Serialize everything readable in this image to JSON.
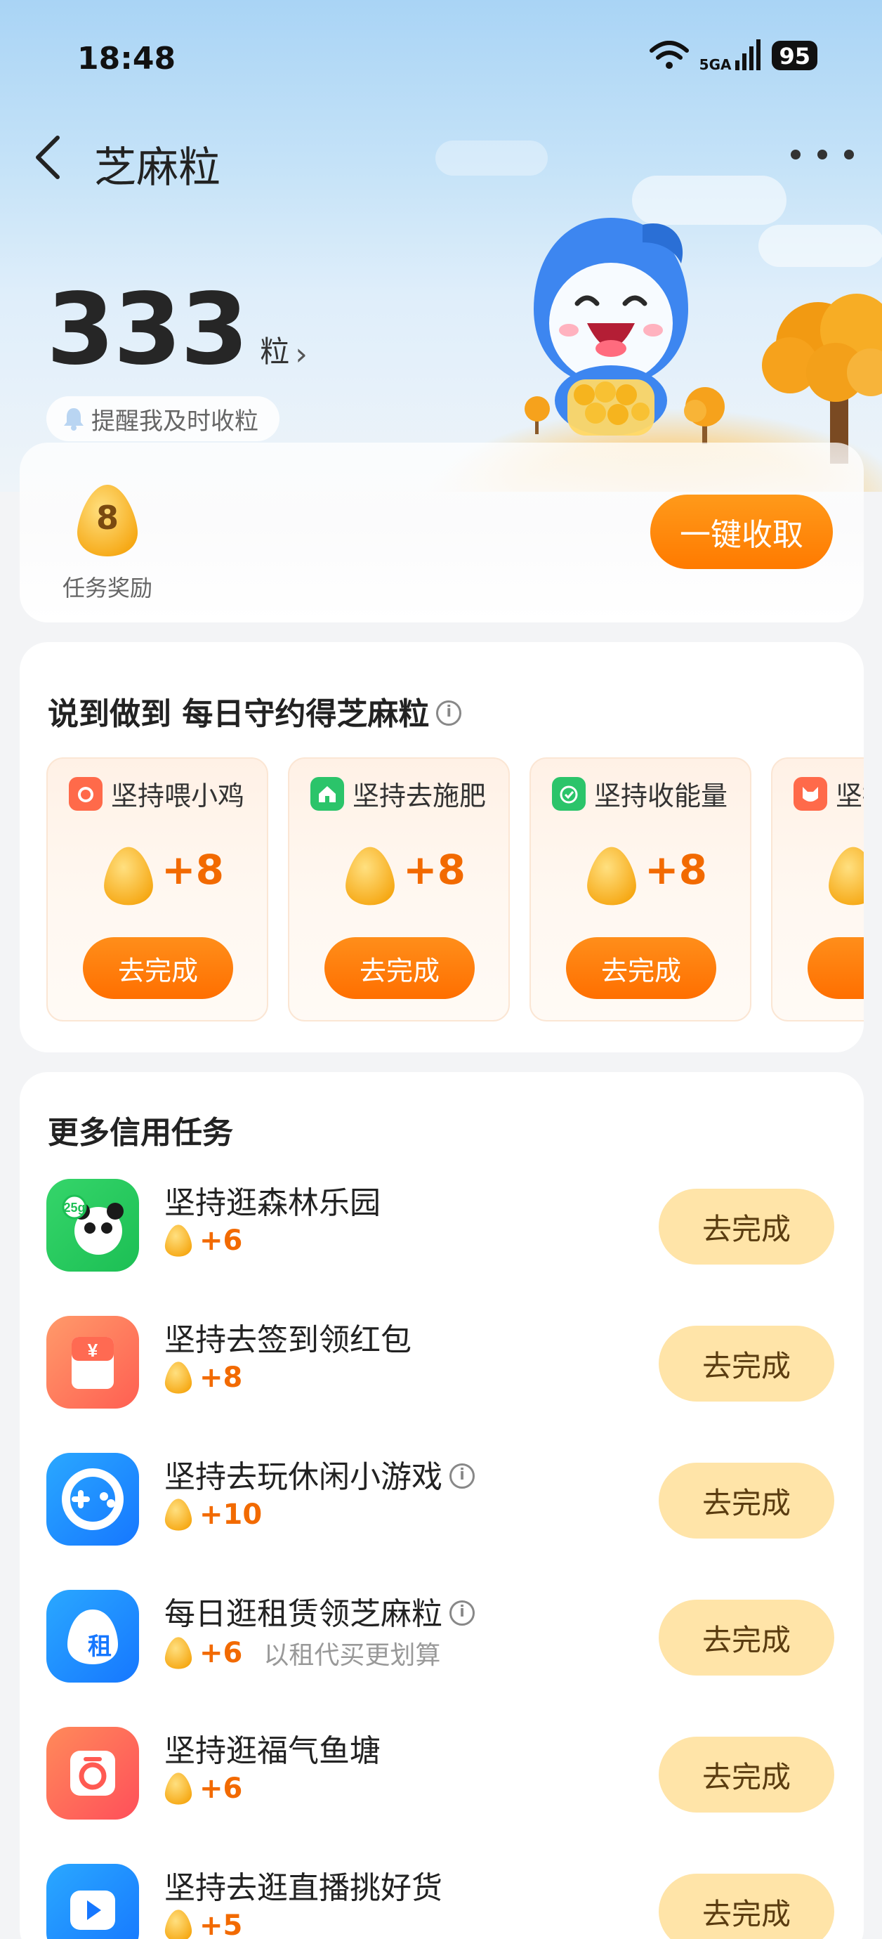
{
  "status_bar": {
    "time": "18:48",
    "network": "5GA",
    "battery": "95"
  },
  "nav": {
    "title": "芝麻粒"
  },
  "balance": {
    "value": "333",
    "unit": "粒",
    "arrow": "›",
    "remind_text": "提醒我及时收粒"
  },
  "reward": {
    "count": "8",
    "label": "任务奖励",
    "collect_button": "一键收取"
  },
  "daily": {
    "title": "说到做到 每日守约得芝麻粒",
    "tiles": [
      {
        "label": "坚持喂小鸡",
        "reward": "+8",
        "button": "去完成",
        "icon": "chick-icon",
        "color": "#ff6a4a"
      },
      {
        "label": "坚持去施肥",
        "reward": "+8",
        "button": "去完成",
        "icon": "farm-icon",
        "color": "#2bc46a"
      },
      {
        "label": "坚持收能量",
        "reward": "+8",
        "button": "去完成",
        "icon": "energy-icon",
        "color": "#2bc46a"
      },
      {
        "label": "坚持",
        "reward": "",
        "button": "去",
        "icon": "fox-icon",
        "color": "#ff6a4a"
      }
    ]
  },
  "more_tasks": {
    "title": "更多信用任务",
    "items": [
      {
        "title": "坚持逛森林乐园",
        "reward": "+6",
        "note": "",
        "button": "去完成",
        "icon": "panda-icon",
        "has_info": false
      },
      {
        "title": "坚持去签到领红包",
        "reward": "+8",
        "note": "",
        "button": "去完成",
        "icon": "red-packet-icon",
        "has_info": false
      },
      {
        "title": "坚持去玩休闲小游戏",
        "reward": "+10",
        "note": "",
        "button": "去完成",
        "icon": "gamepad-icon",
        "has_info": true
      },
      {
        "title": "每日逛租赁领芝麻粒",
        "reward": "+6",
        "note": "以租代买更划算",
        "button": "去完成",
        "icon": "rent-icon",
        "has_info": true
      },
      {
        "title": "坚持逛福气鱼塘",
        "reward": "+6",
        "note": "",
        "button": "去完成",
        "icon": "fish-pond-icon",
        "has_info": false
      },
      {
        "title": "坚持去逛直播挑好货",
        "reward": "+5",
        "note": "",
        "button": "去完成",
        "icon": "live-video-icon",
        "has_info": false
      }
    ]
  }
}
